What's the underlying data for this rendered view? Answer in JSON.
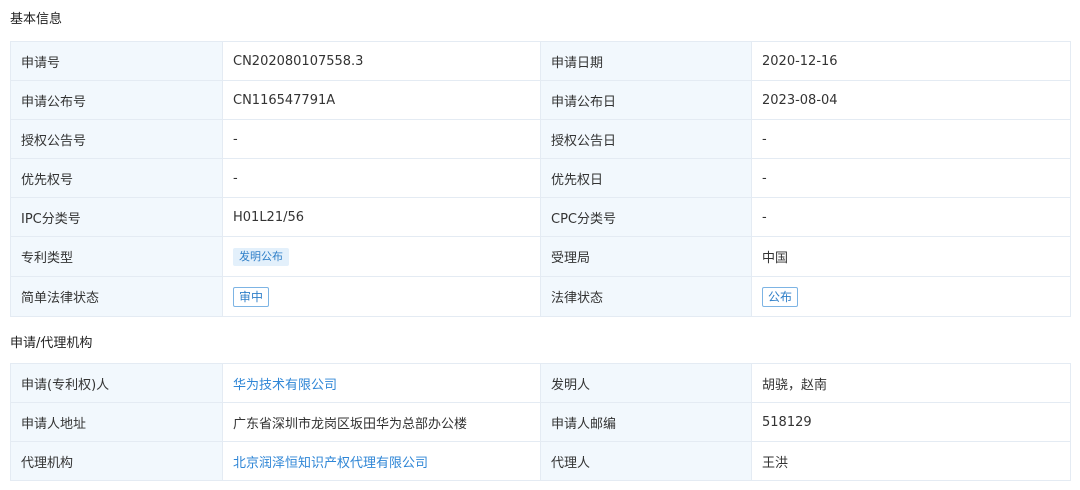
{
  "sections": {
    "basic_title": "基本信息",
    "agency_title": "申请/代理机构"
  },
  "basic": {
    "app_no_label": "申请号",
    "app_no": "CN202080107558.3",
    "app_date_label": "申请日期",
    "app_date": "2020-12-16",
    "pub_no_label": "申请公布号",
    "pub_no": "CN116547791A",
    "pub_date_label": "申请公布日",
    "pub_date": "2023-08-04",
    "grant_no_label": "授权公告号",
    "grant_no": "-",
    "grant_date_label": "授权公告日",
    "grant_date": "-",
    "priority_no_label": "优先权号",
    "priority_no": "-",
    "priority_date_label": "优先权日",
    "priority_date": "-",
    "ipc_label": "IPC分类号",
    "ipc": "H01L21/56",
    "cpc_label": "CPC分类号",
    "cpc": "-",
    "patent_type_label": "专利类型",
    "patent_type": "发明公布",
    "office_label": "受理局",
    "office": "中国",
    "simple_status_label": "简单法律状态",
    "simple_status": "审中",
    "legal_status_label": "法律状态",
    "legal_status": "公布"
  },
  "agency": {
    "applicant_label": "申请(专利权)人",
    "applicant": "华为技术有限公司",
    "inventor_label": "发明人",
    "inventor": "胡骁，赵南",
    "address_label": "申请人地址",
    "address": "广东省深圳市龙岗区坂田华为总部办公楼",
    "postcode_label": "申请人邮编",
    "postcode": "518129",
    "agency_label": "代理机构",
    "agency": "北京润泽恒知识产权代理有限公司",
    "agent_label": "代理人",
    "agent": "王洪"
  },
  "colors": {
    "label_bg": "#f2f8fd",
    "border": "#e4ebf3",
    "link": "#2f86d6",
    "tag_bg": "#e3f0fb"
  }
}
